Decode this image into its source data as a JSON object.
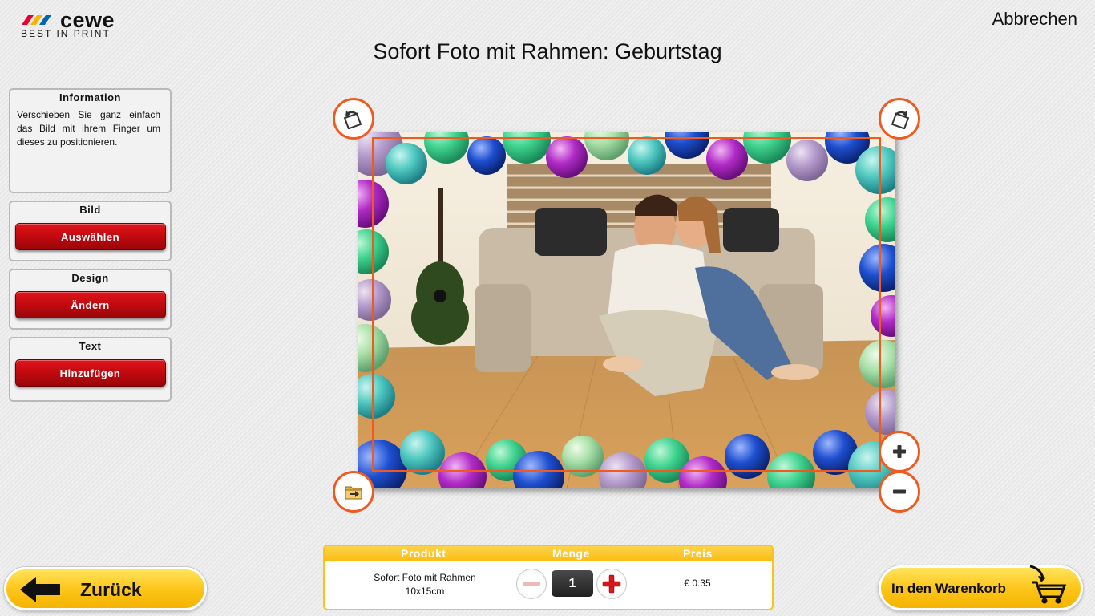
{
  "brand": {
    "name": "cewe",
    "tagline": "BEST IN PRINT",
    "colors": {
      "red": "#e4032e",
      "yellow": "#f7b500",
      "blue": "#0067b1"
    }
  },
  "header": {
    "cancel_label": "Abbrechen",
    "title": "Sofort Foto mit Rahmen: Geburtstag"
  },
  "sidebar": {
    "information": {
      "title": "Information",
      "text": "Verschieben Sie ganz einfach das Bild mit ihrem Finger um dieses zu positionieren."
    },
    "image": {
      "title": "Bild",
      "button": "Auswählen"
    },
    "design": {
      "title": "Design",
      "button": "Ändern"
    },
    "text": {
      "title": "Text",
      "button": "Hinzufügen"
    }
  },
  "editor": {
    "controls": {
      "rotate_left_icon": "rotate-left-icon",
      "rotate_right_icon": "rotate-right-icon",
      "zoom_in_icon": "plus-icon",
      "zoom_out_icon": "minus-icon",
      "folder_icon": "folder-arrow-icon"
    },
    "accent_color": "#f05a1e"
  },
  "order": {
    "headers": {
      "product": "Produkt",
      "quantity": "Menge",
      "price": "Preis"
    },
    "product_line1": "Sofort Foto mit Rahmen",
    "product_line2": "10x15cm",
    "quantity": "1",
    "price": "€ 0.35"
  },
  "footer": {
    "back_label": "Zurück",
    "cart_label": "In den Warenkorb"
  }
}
